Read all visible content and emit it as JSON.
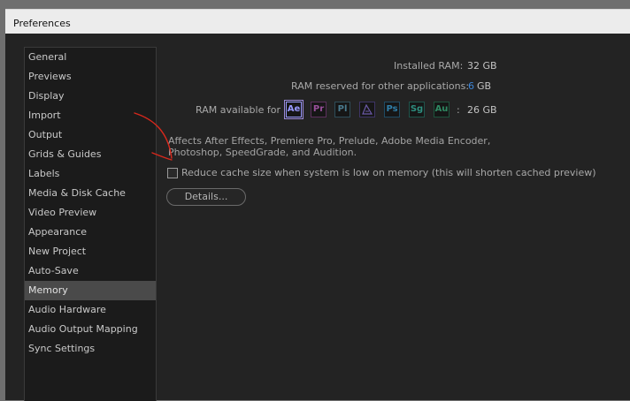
{
  "window": {
    "title": "Preferences"
  },
  "sidebar": {
    "items": [
      {
        "label": "General"
      },
      {
        "label": "Previews"
      },
      {
        "label": "Display"
      },
      {
        "label": "Import"
      },
      {
        "label": "Output"
      },
      {
        "label": "Grids & Guides"
      },
      {
        "label": "Labels"
      },
      {
        "label": "Media & Disk Cache"
      },
      {
        "label": "Video Preview"
      },
      {
        "label": "Appearance"
      },
      {
        "label": "New Project"
      },
      {
        "label": "Auto-Save"
      },
      {
        "label": "Memory",
        "selected": true
      },
      {
        "label": "Audio Hardware"
      },
      {
        "label": "Audio Output Mapping"
      },
      {
        "label": "Sync Settings"
      }
    ]
  },
  "memory": {
    "installed_ram_label": "Installed RAM:",
    "installed_ram_value": "32 GB",
    "reserved_label": "RAM reserved for other applications:",
    "reserved_value": "6",
    "reserved_unit": "GB",
    "available_label": "RAM available for",
    "available_colon": ":",
    "available_value": "26 GB",
    "apps": [
      {
        "label": "Ae",
        "icon": "after-effects-icon",
        "color": "#9999ff",
        "selected": true
      },
      {
        "label": "Pr",
        "icon": "premiere-pro-icon",
        "color": "#9a4f9c"
      },
      {
        "label": "Pl",
        "icon": "prelude-icon",
        "color": "#4a7b8f"
      },
      {
        "label": "",
        "icon": "media-encoder-icon",
        "color": "#6b5aa8"
      },
      {
        "label": "Ps",
        "icon": "photoshop-icon",
        "color": "#2f7ea8"
      },
      {
        "label": "Sg",
        "icon": "speedgrade-icon",
        "color": "#2e8e7f"
      },
      {
        "label": "Au",
        "icon": "audition-icon",
        "color": "#2f8a63"
      }
    ],
    "description": "Affects After Effects, Premiere Pro, Prelude, Adobe Media Encoder, Photoshop, SpeedGrade, and Audition.",
    "checkbox_label": "Reduce cache size when system is low on memory (this will shorten cached preview)",
    "checkbox_checked": false,
    "details_button": "Details..."
  },
  "annotation": {
    "color": "#d9281c"
  }
}
